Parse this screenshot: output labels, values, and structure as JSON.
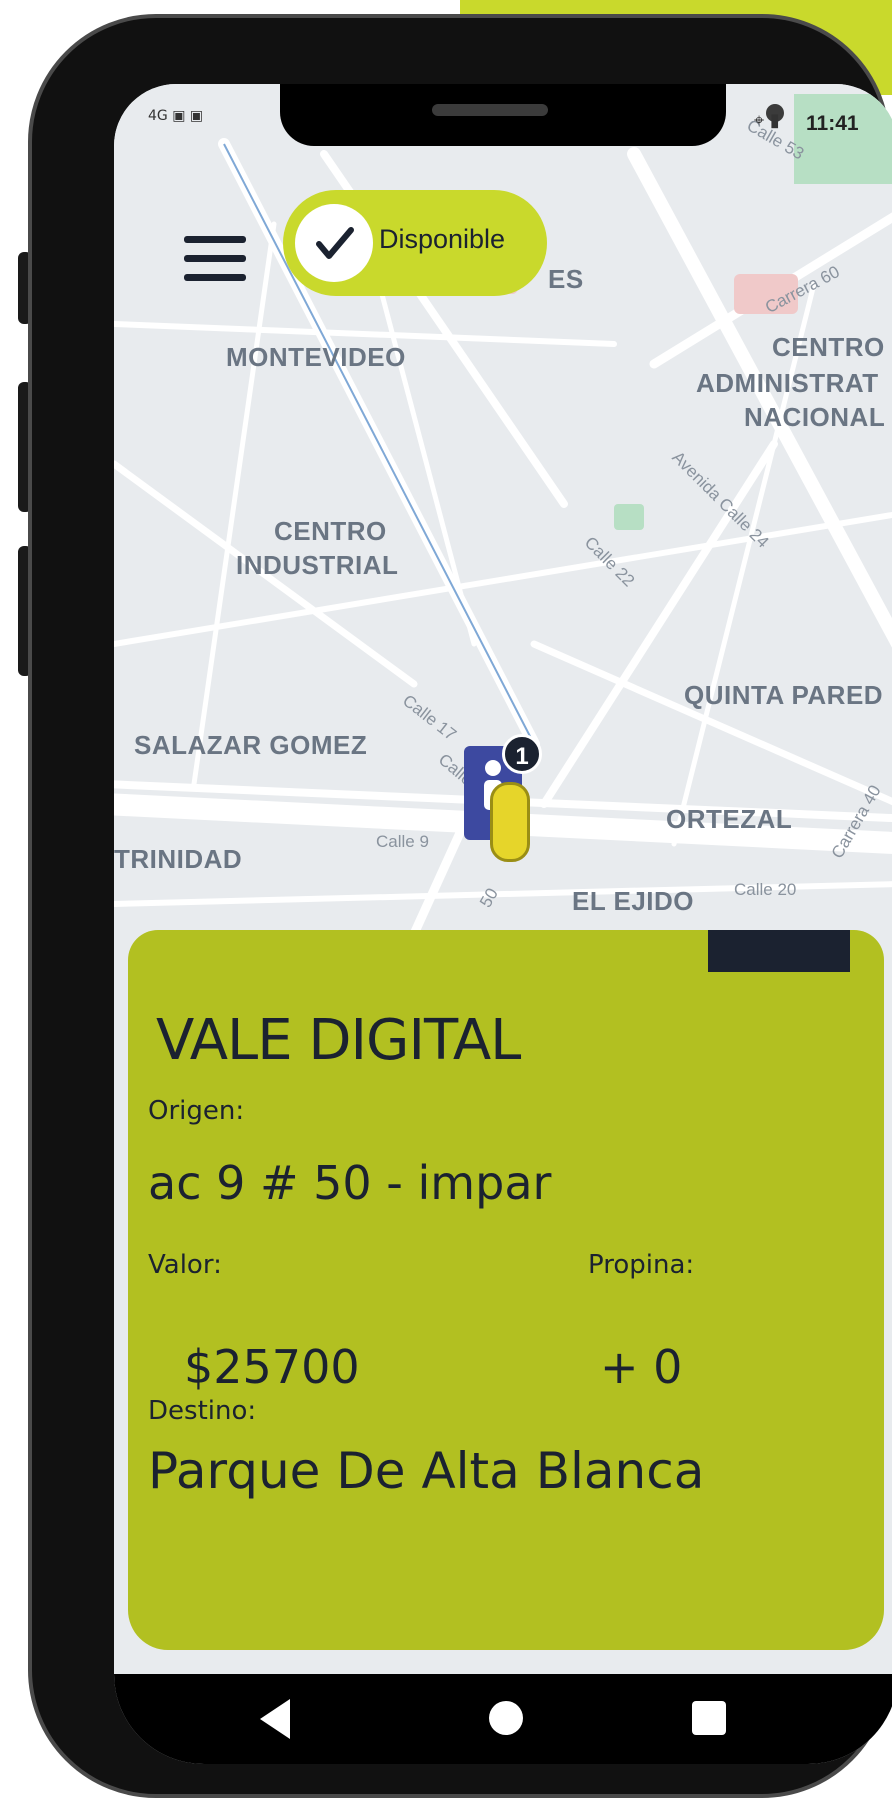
{
  "colors": {
    "accent": "#c9d92c",
    "card": "#b2c021",
    "navy": "#1b2230",
    "map": "#e8ebee",
    "road": "#ffffff",
    "pin": "#3d49a0"
  },
  "status_bar": {
    "signal": "4G",
    "time": "11:41",
    "icons": [
      "signal-icon",
      "image-icon",
      "notification-icon",
      "location-icon",
      "battery-icon"
    ]
  },
  "top": {
    "menu_icon": "hamburger-menu-icon",
    "availability_label": "Disponible",
    "availability_icon": "check-icon"
  },
  "map": {
    "areas": [
      "MONTEVIDEO",
      "CENTRO",
      "ADMINISTRAT",
      "NACIONAL",
      "CENTRO",
      "INDUSTRIAL",
      "QUINTA PARED",
      "SALAZAR GOMEZ",
      "ORTEZAL",
      "TRINIDAD",
      "EL EJIDO",
      "ES"
    ],
    "streets": [
      "Carrera 60",
      "Avenida Calle 24",
      "Calle 22",
      "Calle 17",
      "Calle 9",
      "Calle 20",
      "Carrera 40",
      "Calle 53",
      "50",
      "Calle"
    ],
    "pin_badge": "1"
  },
  "card": {
    "title": "VALE DIGITAL",
    "origin_label": "Origen:",
    "origin_value": "ac 9 # 50 - impar",
    "value_label": "Valor:",
    "value": "$25700",
    "tip_label": "Propina:",
    "tip": "+ 0",
    "dest_label": "Destino:",
    "dest_value": "Parque De Alta Blanca"
  },
  "nav": {
    "back": "back-icon",
    "home": "home-icon",
    "recents": "recents-icon"
  }
}
